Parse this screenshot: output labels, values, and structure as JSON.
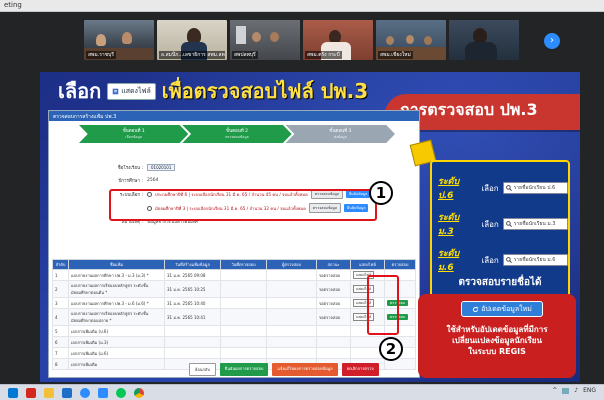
{
  "window": {
    "title": "eting"
  },
  "meeting": {
    "participants": [
      {
        "label": "สพม.ราชบุรี",
        "active": false
      },
      {
        "label": "อ.สมนึก...เลขาธิการ สพม.สต",
        "active": false
      },
      {
        "label": "สพปลพบุรี",
        "active": true
      },
      {
        "label": "สพม.ตรัง กระบี่",
        "active": false
      },
      {
        "label": "สพม.เชียงใหม่",
        "active": false
      },
      {
        "label": "",
        "active": false
      }
    ],
    "next_icon": "chevron-right-icon"
  },
  "slide": {
    "select_word": "เลือก",
    "show_file_button": "แสดงไฟล์",
    "purpose": "เพื่อตรวจสอบไฟล์ ปพ.3",
    "banner": "การตรวจสอบ ปพ.3",
    "web": {
      "topbar": "ตรวจสอบการสร้างแฟ้ม ปพ.3",
      "steps": [
        {
          "title": "ขั้นตอนที่ 1",
          "sub": "เลือกข้อมูล"
        },
        {
          "title": "ขั้นตอนที่ 2",
          "sub": "ตรวจสอบข้อมูล"
        },
        {
          "title": "ขั้นตอนที่ 3",
          "sub": "ส่งข้อมูล"
        }
      ],
      "form": {
        "school_label": "ชื่อโรงเรียน :",
        "school_value": "01020101",
        "year_label": "ปีการศึกษา :",
        "year_value": "2564",
        "radio_label": "ระบบเลือก :",
        "radio_1": "ประถมศึกษาปีที่ 6 | ระบบเลือกนักเรียน 31 มี.ค. 65 / จำนวน 45 คน / จบแล้วทั้งหมด",
        "radio_2": "มัธยมศึกษาปีที่ 3 | ระบบเลือกนักเรียน 31 มี.ค. 65 / จำนวน 32 คน / จบแล้วทั้งหมด",
        "btn_check": "ตรวจสอบข้อมูล",
        "btn_send": "ยืนยันข้อมูล",
        "note_label": "หมายเหตุ :",
        "note_value": "ข้อมูลจากระบบสารสนเทศ"
      },
      "table": {
        "headers": [
          "ลำดับ",
          "ชื่อแฟ้ม",
          "วันที่สร้างแฟ้มข้อมูล",
          "วันที่ตรวจสอบ",
          "ผู้ตรวจสอบ",
          "สถานะ",
          "แสดงไฟล์",
          "ตรวจสอบ"
        ],
        "rows": [
          {
            "no": "1",
            "name": "แบบรายงานผลการศึกษา ปพ.3 - ม.3 (ม.3) *",
            "created": "31 ม.ค. 2565 09:08",
            "checked": "",
            "checker": "",
            "status": "รอตรวจสอบ",
            "show": "แสดงไฟล์",
            "action": ""
          },
          {
            "no": "2",
            "name": "แบบรายงานผลการเรียนจบหลักสูตร ระดับชั้นมัธยมศึกษาตอนต้น *",
            "created": "31 ม.ค. 2565 10:25",
            "checked": "",
            "checker": "",
            "status": "รอตรวจสอบ",
            "show": "แสดงไฟล์",
            "action": ""
          },
          {
            "no": "3",
            "name": "แบบรายงานผลการศึกษา ปพ.3 - ม.6 (ม.6) *",
            "created": "31 ม.ค. 2565 10:40",
            "checked": "",
            "checker": "",
            "status": "รอตรวจสอบ",
            "show": "แสดงไฟล์",
            "action": "ตรวจสอบ"
          },
          {
            "no": "4",
            "name": "แบบรายงานผลการเรียนจบหลักสูตร ระดับชั้นมัธยมศึกษาตอนปลาย *",
            "created": "31 ม.ค. 2565 10:41",
            "checked": "",
            "checker": "",
            "status": "รอตรวจสอบ",
            "show": "แสดงไฟล์",
            "action": "ตรวจสอบ"
          },
          {
            "no": "5",
            "name": "เอกสารเพิ่มเติม (ป.6)",
            "created": "",
            "checked": "",
            "checker": "",
            "status": "",
            "show": "",
            "action": ""
          },
          {
            "no": "6",
            "name": "เอกสารเพิ่มเติม (ม.3)",
            "created": "",
            "checked": "",
            "checker": "",
            "status": "",
            "show": "",
            "action": ""
          },
          {
            "no": "7",
            "name": "เอกสารเพิ่มเติม (ม.6)",
            "created": "",
            "checked": "",
            "checker": "",
            "status": "",
            "show": "",
            "action": ""
          },
          {
            "no": "8",
            "name": "เอกสารเพิ่มเติม",
            "created": "",
            "checked": "",
            "checker": "",
            "status": "",
            "show": "",
            "action": ""
          }
        ]
      },
      "bottom_buttons": [
        "ย้อนกลับ",
        "ยืนยันผลการตรวจสอบ",
        "แจ้งแก้ไขผลการตรวจสอบข้อมูล",
        "ยกเลิกการตรวจ"
      ],
      "markers": [
        "1",
        "2"
      ]
    },
    "panel_levels": {
      "rows": [
        {
          "level": "ระดับ ป.6",
          "pick": "เลือก",
          "placeholder": "รายชื่อนักเรียน ป.6"
        },
        {
          "level": "ระดับ ม.3",
          "pick": "เลือก",
          "placeholder": "รายชื่อนักเรียน ม.3"
        },
        {
          "level": "ระดับ ม.6",
          "pick": "เลือก",
          "placeholder": "รายชื่อนักเรียน ม.6"
        }
      ],
      "footer": "ตรวจสอบรายชื่อได้"
    },
    "panel_update": {
      "button": "อัปเดตข้อมูลใหม่",
      "text_1": "ใช้สำหรับอัปเดตข้อมูลที่มีการ",
      "text_2": "เปลี่ยนแปลงข้อมูลนักเรียน",
      "text_3": "ในระบบ REGIS"
    }
  },
  "taskbar": {
    "icons": [
      "windows-icon",
      "pdf-icon",
      "folder-icon",
      "outlook-icon",
      "zoom-icon",
      "line-icon",
      "chrome-icon",
      "word-icon",
      "chrome-alt-icon"
    ],
    "tray_lang": "ENG"
  },
  "colors": {
    "slide_bg": "#1d2f86",
    "accent_yellow": "#ffe044",
    "banner_red": "#c9352f",
    "marker_red": "#e0131a"
  }
}
